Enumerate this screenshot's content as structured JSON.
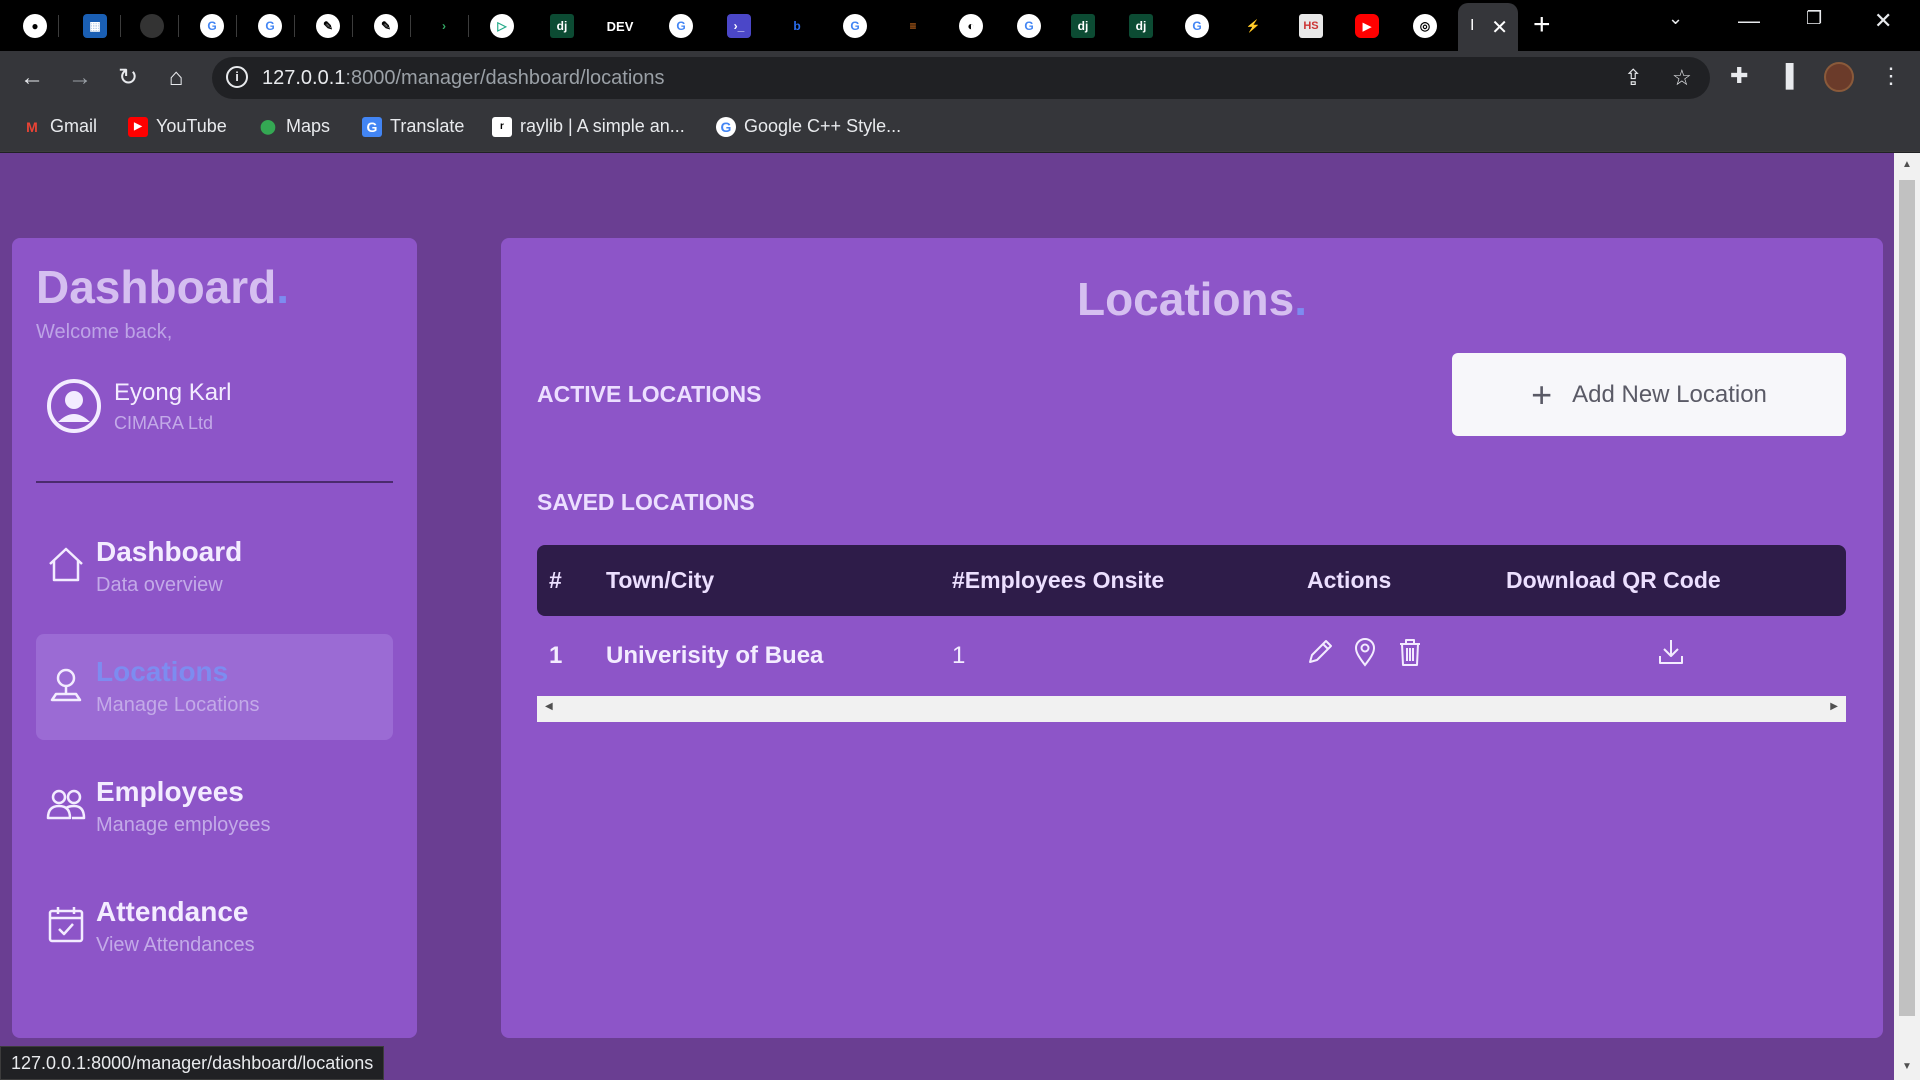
{
  "browser": {
    "active_tab_title": "I",
    "url_host": "127.0.0.1",
    "url_rest": ":8000/manager/dashboard/locations",
    "bookmarks": [
      {
        "label": "Gmail",
        "icon": "gmail-icon",
        "color": "#ea4335",
        "glyph": "M"
      },
      {
        "label": "YouTube",
        "icon": "youtube-icon",
        "color": "#ff0000",
        "glyph": "▶"
      },
      {
        "label": "Maps",
        "icon": "maps-icon",
        "color": "#34a853",
        "glyph": "⬤"
      },
      {
        "label": "Translate",
        "icon": "translate-icon",
        "color": "#4285f4",
        "glyph": "G"
      },
      {
        "label": "raylib | A simple an...",
        "icon": "raylib-icon",
        "color": "#ffffff",
        "glyph": "r"
      },
      {
        "label": "Google C++ Style...",
        "icon": "google-icon",
        "color": "#ffffff",
        "glyph": "G"
      }
    ],
    "status_url": "127.0.0.1:8000/manager/dashboard/locations"
  },
  "sidebar": {
    "brand": "Dashboard",
    "brand_dot": ".",
    "welcome": "Welcome back,",
    "user_name": "Eyong Karl",
    "user_org": "CIMARA Ltd",
    "items": [
      {
        "title": "Dashboard",
        "subtitle": "Data overview"
      },
      {
        "title": "Locations",
        "subtitle": "Manage Locations"
      },
      {
        "title": "Employees",
        "subtitle": "Manage employees"
      },
      {
        "title": "Attendance",
        "subtitle": "View Attendances"
      }
    ]
  },
  "main": {
    "title": "Locations",
    "title_dot": ".",
    "active_label": "ACTIVE LOCATIONS",
    "add_button": "Add New Location",
    "saved_label": "SAVED LOCATIONS",
    "columns": [
      "#",
      "Town/City",
      "#Employees Onsite",
      "Actions",
      "Download QR Code"
    ],
    "rows": [
      {
        "index": "1",
        "town": "Univerisity of Buea",
        "employees": "1"
      }
    ]
  },
  "colors": {
    "page_bg": "#6a3e92",
    "panel_bg": "#8d55c8",
    "accent": "#7d8cf0",
    "table_head": "#2e1c49"
  }
}
